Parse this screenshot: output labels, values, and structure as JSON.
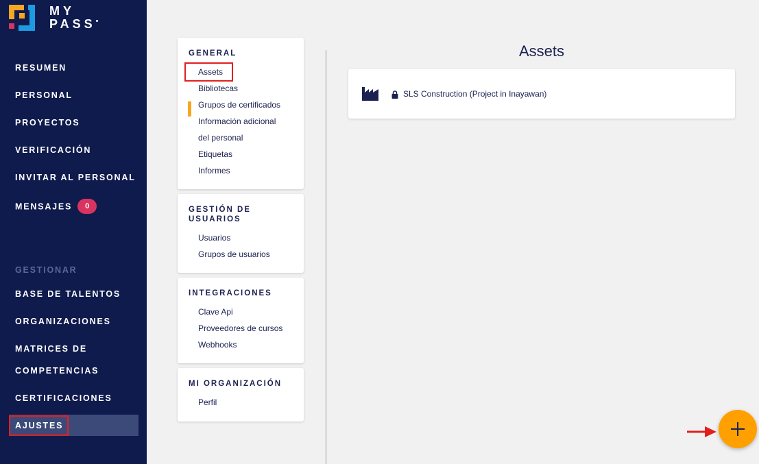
{
  "brand": {
    "line1": "MY",
    "line2": "PASS",
    "colors": {
      "orange": "#f5a623",
      "blue": "#1e9be0",
      "pink": "#d8345f",
      "navy": "#0f1b4d"
    }
  },
  "sidebar": {
    "items": [
      {
        "label": "RESUMEN"
      },
      {
        "label": "PERSONAL"
      },
      {
        "label": "PROYECTOS"
      },
      {
        "label": "VERIFICACIÓN"
      },
      {
        "label": "INVITAR AL PERSONAL"
      },
      {
        "label": "MENSAJES",
        "badge": "0"
      }
    ],
    "section_label": "GESTIONAR",
    "manage_items": [
      {
        "label": "BASE DE TALENTOS"
      },
      {
        "label": "ORGANIZACIONES"
      },
      {
        "label_line1": "MATRICES DE",
        "label_line2": "COMPETENCIAS"
      },
      {
        "label": "CERTIFICACIONES"
      },
      {
        "label": "AJUSTES",
        "active": true
      }
    ]
  },
  "settings": {
    "general": {
      "title": "GENERAL",
      "items": [
        "Assets",
        "Bibliotecas",
        "Grupos de certificados",
        "Información adicional",
        "del personal",
        "Etiquetas",
        "Informes"
      ]
    },
    "user_management": {
      "title_line1": "GESTIÓN DE",
      "title_line2": "USUARIOS",
      "items": [
        "Usuarios",
        "Grupos de usuarios"
      ]
    },
    "integrations": {
      "title": "INTEGRACIONES",
      "items": [
        "Clave Api",
        "Proveedores de cursos",
        "Webhooks"
      ]
    },
    "organization": {
      "title": "MI ORGANIZACIÓN",
      "items": [
        "Perfil"
      ]
    }
  },
  "main": {
    "title": "Assets",
    "assets": [
      {
        "name": "SLS Construction (Project in Inayawan)",
        "icon": "factory-icon",
        "locked": true
      }
    ],
    "fab_icon": "plus-icon",
    "accent": "#ffa000"
  }
}
